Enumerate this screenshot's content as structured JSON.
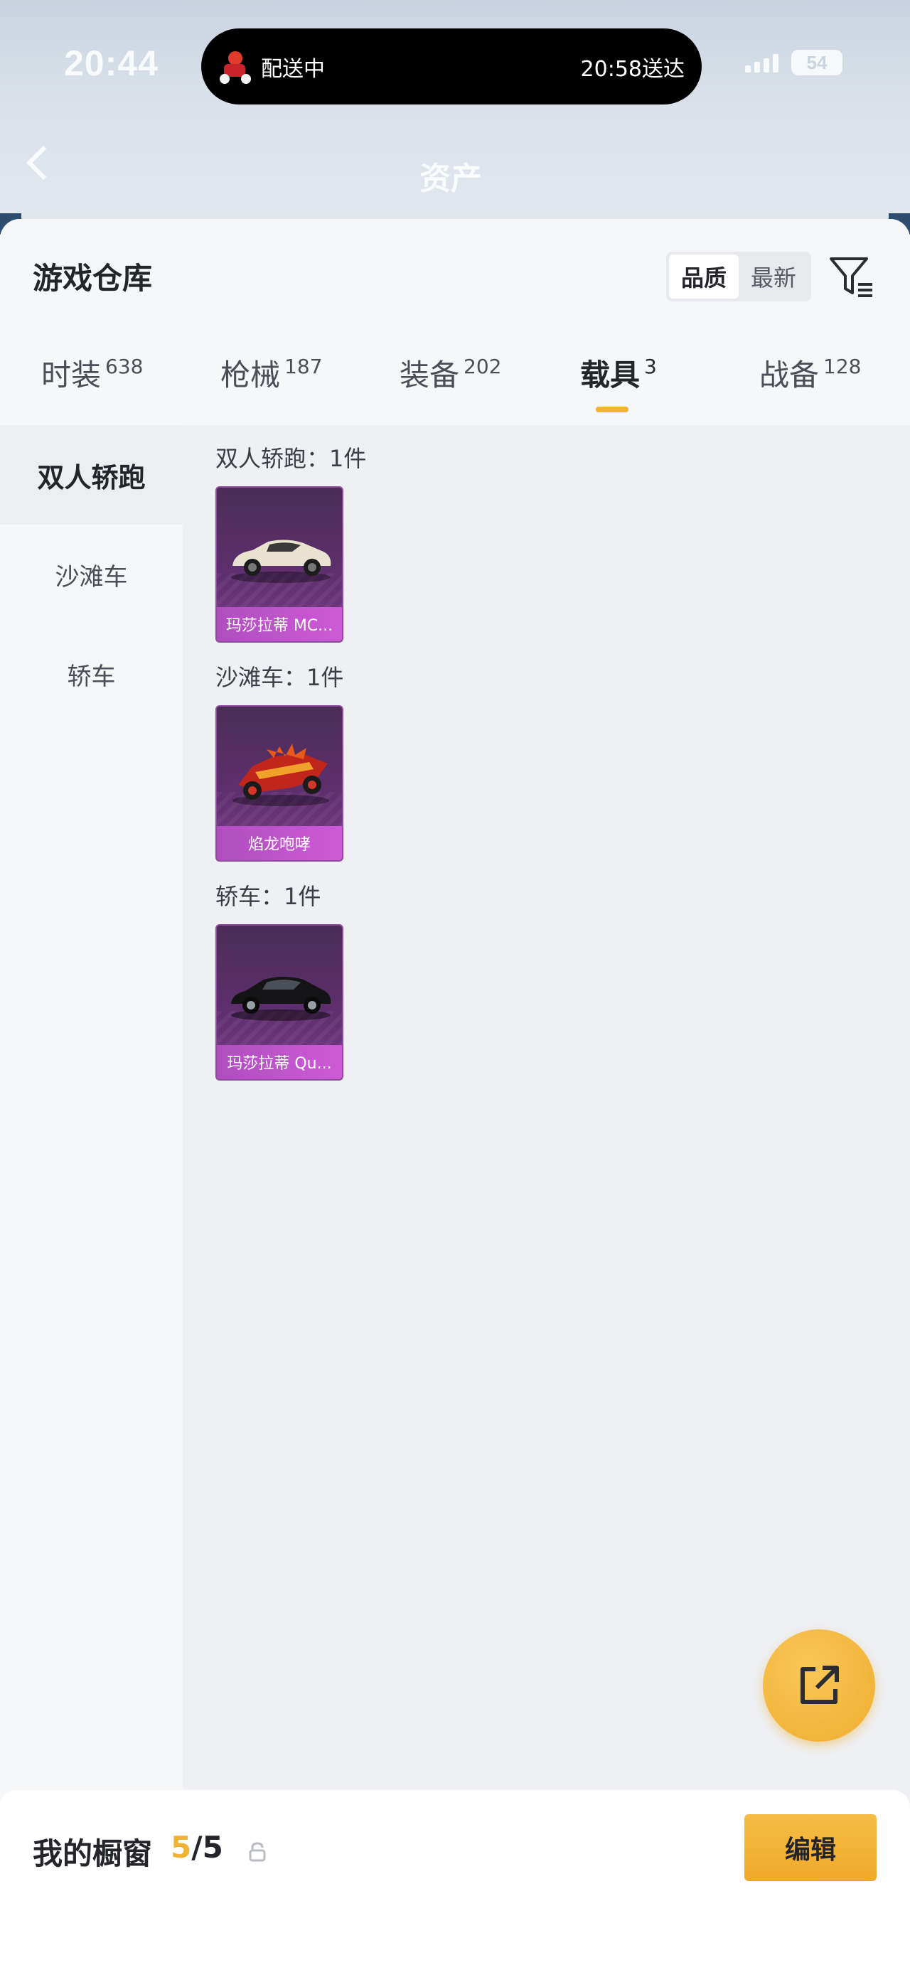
{
  "status_bar": {
    "time": "20:44",
    "battery": "54"
  },
  "island": {
    "label": "配送中",
    "eta": "20:58送达"
  },
  "ghost_header": {
    "title": "资产"
  },
  "header": {
    "title": "游戏仓库",
    "sort": {
      "options": [
        "品质",
        "最新"
      ],
      "selected": "品质"
    }
  },
  "tabs": [
    {
      "label": "时装",
      "count": "638"
    },
    {
      "label": "枪械",
      "count": "187"
    },
    {
      "label": "装备",
      "count": "202"
    },
    {
      "label": "载具",
      "count": "3",
      "active": true
    },
    {
      "label": "战备",
      "count": "128"
    }
  ],
  "categories": [
    {
      "label": "双人轿跑",
      "active": true
    },
    {
      "label": "沙滩车"
    },
    {
      "label": "轿车"
    }
  ],
  "groups": [
    {
      "title": "双人轿跑：1件",
      "items": [
        {
          "name": "玛莎拉蒂 MC...",
          "vehicle": "white-sports-car"
        }
      ]
    },
    {
      "title": "沙滩车：1件",
      "items": [
        {
          "name": "焰龙咆哮",
          "vehicle": "red-dragon-buggy"
        }
      ]
    },
    {
      "title": "轿车：1件",
      "items": [
        {
          "name": "玛莎拉蒂 Qu...",
          "vehicle": "black-sedan"
        }
      ]
    }
  ],
  "showcase": {
    "label": "我的橱窗",
    "current": "5",
    "total": "/5",
    "edit_label": "编辑"
  },
  "colors": {
    "accent": "#f2b233",
    "card_purple": "#5e2f6e",
    "name_bar": "#c055cc"
  }
}
